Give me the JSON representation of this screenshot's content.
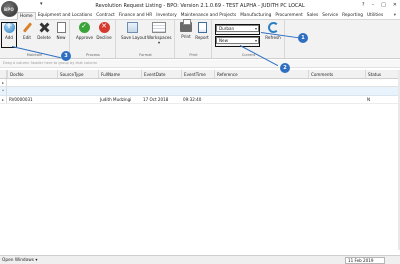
{
  "window": {
    "title": "Revolution Request Listing - BPO: Version 2.1.0.69 - TEST ALPHA - JUDITH PC LOCAL",
    "logo_text": "BPO",
    "qat_arrow": "▾",
    "controls": {
      "help": "?",
      "minimize": "–",
      "maximize": "□",
      "close": "✕"
    }
  },
  "menu": {
    "tabs": [
      "Home",
      "Equipment and Locations",
      "Contract",
      "Finance and HR",
      "Inventory",
      "Maintenance and Projects",
      "Manufacturing",
      "Procurement",
      "Sales",
      "Service",
      "Reporting",
      "Utilities"
    ],
    "more_arrow": "▾"
  },
  "ribbon": {
    "maintain": {
      "label": "Maintain",
      "buttons": [
        {
          "label": "Add",
          "icon": "add-icon"
        },
        {
          "label": "Edit",
          "icon": "edit-icon"
        },
        {
          "label": "Delete",
          "icon": "delete-icon"
        },
        {
          "label": "New",
          "icon": "new-document-icon"
        }
      ]
    },
    "process": {
      "label": "Process",
      "buttons": [
        {
          "label": "Approve",
          "icon": "approve-icon"
        },
        {
          "label": "Decline",
          "icon": "decline-icon"
        }
      ]
    },
    "format": {
      "label": "Format",
      "buttons": [
        {
          "label": "Save Layout",
          "icon": "save-layout-icon"
        },
        {
          "label": "Workspaces",
          "icon": "workspaces-icon",
          "arrow": "▾"
        }
      ]
    },
    "print": {
      "label": "Print",
      "buttons": [
        {
          "label": "Print",
          "icon": "print-icon"
        },
        {
          "label": "Report",
          "icon": "report-icon"
        }
      ]
    },
    "current": {
      "label": "Current",
      "site_value": "Durban",
      "status_value": "New",
      "refresh_label": "Refresh"
    }
  },
  "callouts": [
    "1",
    "2",
    "3"
  ],
  "group_panel_text": "Drag a column header here to group by that column",
  "grid": {
    "columns": [
      "DocNo",
      "SourceType",
      "FullName",
      "EventDate",
      "EventTime",
      "Reference",
      "Comments",
      "Status"
    ],
    "filter_marker": "▸",
    "new_row_marker": "*",
    "rows": [
      {
        "marker": "▸",
        "DocNo": "RV0000031",
        "SourceType": "",
        "FullName": "Judith Mudzingi",
        "EventDate": "17 Oct 2018",
        "EventTime": "09:32:40",
        "Reference": "",
        "Comments": "",
        "Status": "N"
      }
    ]
  },
  "statusbar": {
    "open_windows": "Open Windows",
    "open_windows_arrow": "▾",
    "date": "11 Feb 2019"
  }
}
